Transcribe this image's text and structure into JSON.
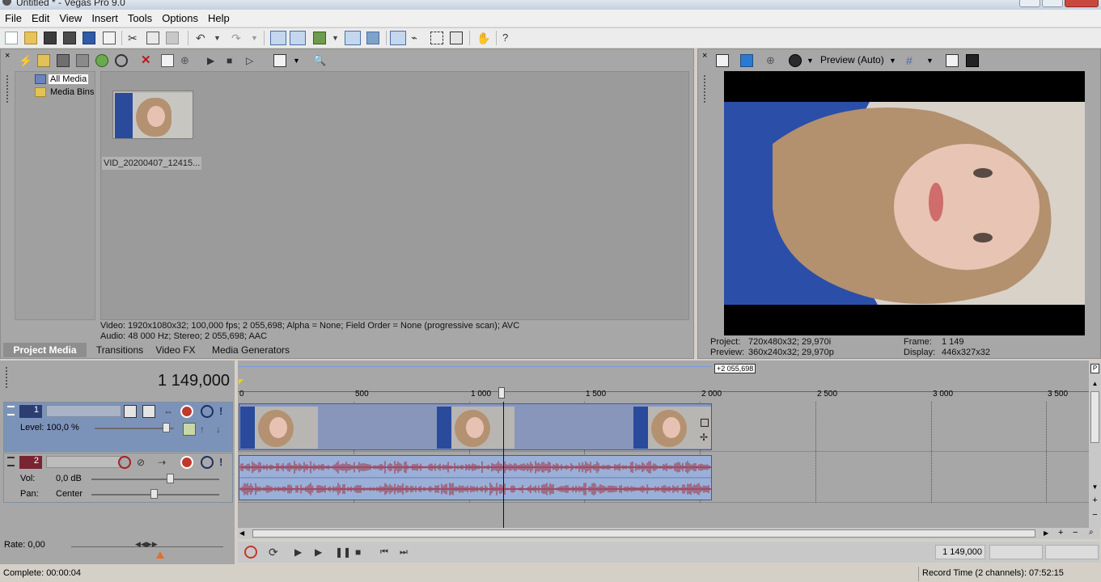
{
  "window": {
    "title": "Untitled * - Vegas Pro 9.0"
  },
  "menu": [
    "File",
    "Edit",
    "View",
    "Insert",
    "Tools",
    "Options",
    "Help"
  ],
  "toolbar_icons": [
    "new-icon",
    "open-icon",
    "save-icon",
    "save-as-icon",
    "render-icon",
    "properties-icon",
    "cut-icon",
    "copy-icon",
    "paste-icon",
    "undo-icon",
    "redo-icon",
    "auto-ripple-icon",
    "snapping-icon",
    "edit-tool-icon",
    "envelope-tool-icon",
    "selection-tool-icon",
    "zoom-tool-icon",
    "normal-edit-icon",
    "help-icon"
  ],
  "project_media": {
    "tree": [
      {
        "label": "All Media",
        "selected": true
      },
      {
        "label": "Media Bins",
        "selected": false
      }
    ],
    "item_label": "VID_20200407_12415...",
    "info_video": "Video: 1920x1080x32; 100,000 fps; 2 055,698; Alpha = None; Field Order = None (progressive scan); AVC",
    "info_audio": "Audio: 48 000 Hz; Stereo; 2 055,698; AAC"
  },
  "tabs": [
    {
      "label": "Project Media",
      "active": true
    },
    {
      "label": "Transitions",
      "active": false
    },
    {
      "label": "Video FX",
      "active": false
    },
    {
      "label": "Media Generators",
      "active": false
    }
  ],
  "preview": {
    "mode": "Preview (Auto)",
    "project_label": "Project:",
    "project_value": "720x480x32; 29,970i",
    "preview_label": "Preview:",
    "preview_value": "360x240x32; 29,970p",
    "frame_label": "Frame:",
    "frame_value": "1 149",
    "display_label": "Display:",
    "display_value": "446x327x32"
  },
  "timeline": {
    "timecode": "1 149,000",
    "end_marker": "+2 055,698",
    "ruler_ticks": [
      "0",
      "500",
      "1 000",
      "1 500",
      "2 000",
      "2 500",
      "3 000",
      "3 500"
    ],
    "track1": {
      "number": "1",
      "level_label": "Level: 100,0 %"
    },
    "track2": {
      "number": "2",
      "vol_label": "Vol:",
      "vol_value": "0,0 dB",
      "pan_label": "Pan:",
      "pan_value": "Center"
    },
    "rate": "Rate: 0,00",
    "position": "1 149,000"
  },
  "status": {
    "complete": "Complete: 00:00:04",
    "record_time": "Record Time (2 channels): 07:52:15"
  },
  "colors": {
    "video_track": "#7c93b9",
    "audio_wave": "#a02a3c",
    "track2_num": "#7a2432",
    "track1_num": "#2c3d72"
  }
}
